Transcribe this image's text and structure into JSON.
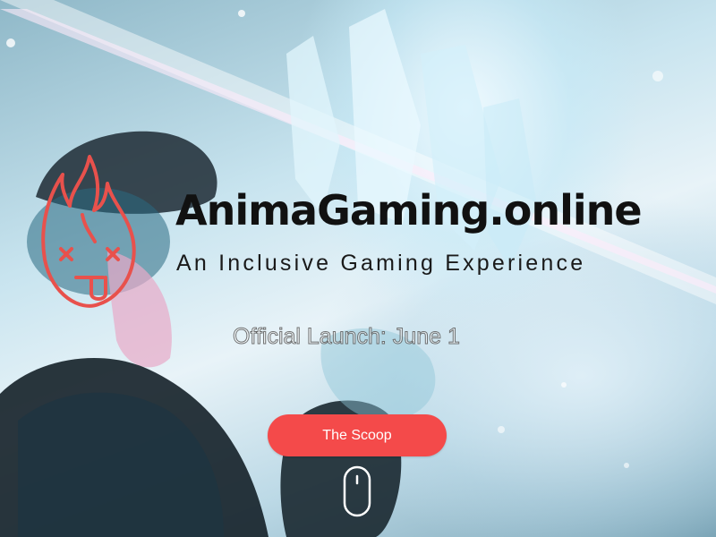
{
  "hero": {
    "site_title": "AnimaGaming.online",
    "tagline": "An Inclusive Gaming Experience",
    "launch_text": "Official Launch: June 1",
    "cta_label": "The Scoop",
    "scroll_icon": "mouse-scroll-icon",
    "logo_icon": "flame-face-icon",
    "background": "game-character-crystal-artwork"
  },
  "colors": {
    "accent": "#f44a4a",
    "logo": "#e8514c",
    "title": "#111111",
    "cta_text": "#ffffff"
  }
}
